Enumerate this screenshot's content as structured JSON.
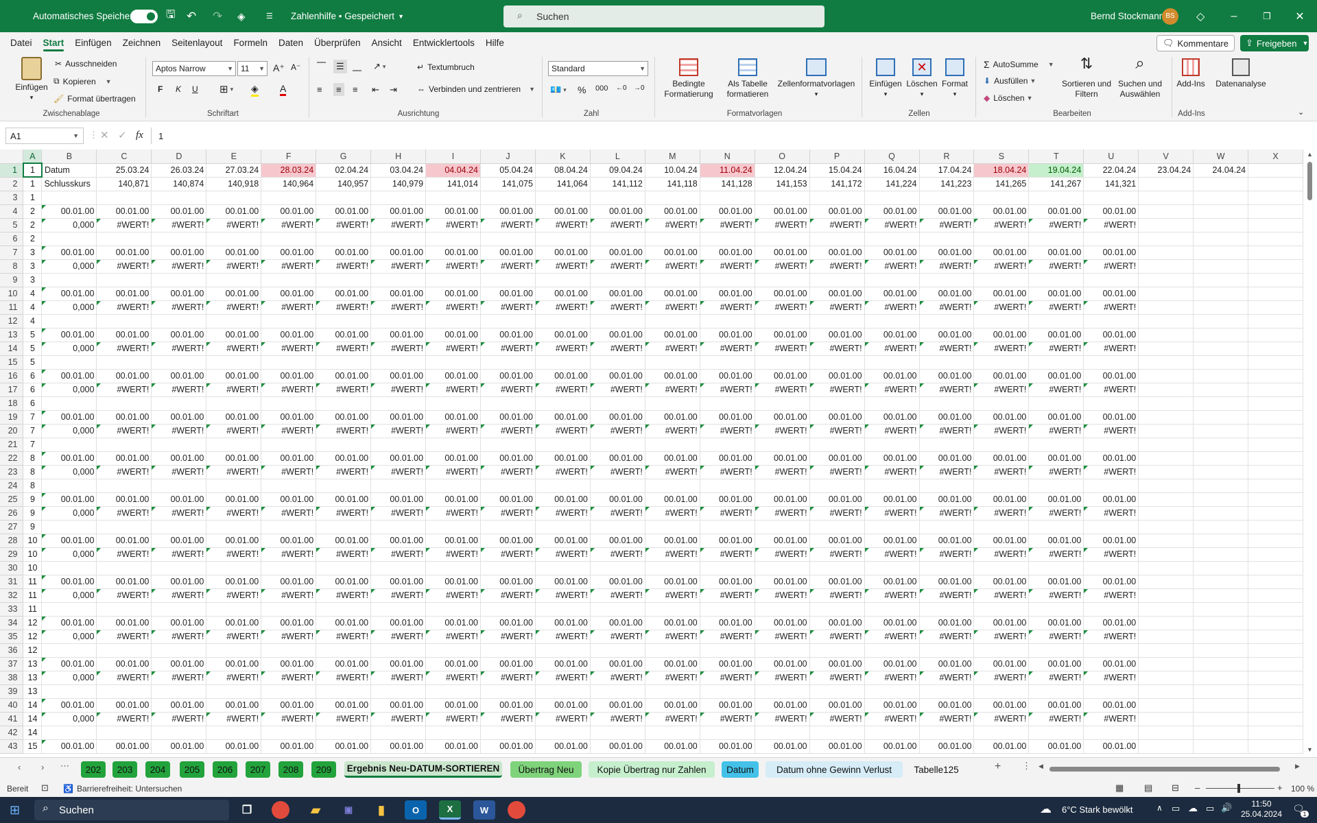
{
  "titlebar": {
    "autosave_label": "Automatisches Speichern",
    "document_title": "Zahlenhilfe • Gespeichert",
    "search_placeholder": "Suchen",
    "user_name": "Bernd Stockmann",
    "user_initials": "BS",
    "minimize": "–",
    "maximize": "❐",
    "close": "✕"
  },
  "menu": {
    "items": [
      "Datei",
      "Start",
      "Einfügen",
      "Zeichnen",
      "Seitenlayout",
      "Formeln",
      "Daten",
      "Überprüfen",
      "Ansicht",
      "Entwicklertools",
      "Hilfe"
    ],
    "active": "Start",
    "comments": "Kommentare",
    "share": "Freigeben"
  },
  "ribbon": {
    "clipboard": {
      "paste": "Einfügen",
      "cut": "Ausschneiden",
      "copy": "Kopieren",
      "format_painter": "Format übertragen",
      "label": "Zwischenablage"
    },
    "font": {
      "font_name": "Aptos Narrow",
      "font_size": "11",
      "bold": "F",
      "italic": "K",
      "underline": "U",
      "label": "Schriftart"
    },
    "alignment": {
      "wrap": "Textumbruch",
      "merge": "Verbinden und zentrieren",
      "label": "Ausrichtung"
    },
    "number": {
      "format": "Standard",
      "label": "Zahl"
    },
    "styles": {
      "conditional": "Bedingte Formatierung",
      "as_table": "Als Tabelle formatieren",
      "cell_styles": "Zellenformatvorlagen",
      "label": "Formatvorlagen"
    },
    "cells": {
      "insert": "Einfügen",
      "delete": "Löschen",
      "format": "Format",
      "label": "Zellen"
    },
    "editing": {
      "autosum": "AutoSumme",
      "fill": "Ausfüllen",
      "clear": "Löschen",
      "sort": "Sortieren und Filtern",
      "find": "Suchen und Auswählen",
      "label": "Bearbeiten"
    },
    "addins": {
      "addins": "Add-Ins",
      "analyze": "Datenanalyse",
      "label": "Add-Ins"
    }
  },
  "formula_bar": {
    "name_box": "A1",
    "fx": "fx",
    "content": "1"
  },
  "grid": {
    "columns": [
      "A",
      "B",
      "C",
      "D",
      "E",
      "F",
      "G",
      "H",
      "I",
      "J",
      "K",
      "L",
      "M",
      "N",
      "O",
      "P",
      "Q",
      "R",
      "S",
      "T",
      "U",
      "V",
      "W",
      "X"
    ],
    "dates": [
      "25.03.24",
      "26.03.24",
      "27.03.24",
      "28.03.24",
      "02.04.24",
      "03.04.24",
      "04.04.24",
      "05.04.24",
      "08.04.24",
      "09.04.24",
      "10.04.24",
      "11.04.24",
      "12.04.24",
      "15.04.24",
      "16.04.24",
      "17.04.24",
      "18.04.24",
      "19.04.24",
      "22.04.24",
      "23.04.24",
      "24.04.24"
    ],
    "kurse": [
      "140,871",
      "140,874",
      "140,918",
      "140,964",
      "140,957",
      "140,979",
      "141,014",
      "141,075",
      "141,064",
      "141,112",
      "141,118",
      "141,128",
      "141,153",
      "141,172",
      "141,224",
      "141,223",
      "141,265",
      "141,267",
      "141,321"
    ],
    "row1_label": "Datum",
    "row2_label": "Schlusskurs",
    "date_cell": "00.01.00",
    "error_cell": "#WERT!",
    "zero_cell": "0,000",
    "rows": [
      {
        "n": "1",
        "a": "1",
        "kind": "date"
      },
      {
        "n": "2",
        "a": "1",
        "kind": "kurs"
      },
      {
        "n": "3",
        "a": "1",
        "kind": "empty"
      },
      {
        "n": "4",
        "a": "2",
        "kind": "d"
      },
      {
        "n": "5",
        "a": "2",
        "kind": "e"
      },
      {
        "n": "6",
        "a": "2",
        "kind": "empty"
      },
      {
        "n": "7",
        "a": "3",
        "kind": "d"
      },
      {
        "n": "8",
        "a": "3",
        "kind": "e"
      },
      {
        "n": "9",
        "a": "3",
        "kind": "empty"
      },
      {
        "n": "10",
        "a": "4",
        "kind": "d"
      },
      {
        "n": "11",
        "a": "4",
        "kind": "e"
      },
      {
        "n": "12",
        "a": "4",
        "kind": "empty"
      },
      {
        "n": "13",
        "a": "5",
        "kind": "d"
      },
      {
        "n": "14",
        "a": "5",
        "kind": "e"
      },
      {
        "n": "15",
        "a": "5",
        "kind": "empty"
      },
      {
        "n": "16",
        "a": "6",
        "kind": "d"
      },
      {
        "n": "17",
        "a": "6",
        "kind": "e"
      },
      {
        "n": "18",
        "a": "6",
        "kind": "empty"
      },
      {
        "n": "19",
        "a": "7",
        "kind": "d"
      },
      {
        "n": "20",
        "a": "7",
        "kind": "e"
      },
      {
        "n": "21",
        "a": "7",
        "kind": "empty"
      },
      {
        "n": "22",
        "a": "8",
        "kind": "d"
      },
      {
        "n": "23",
        "a": "8",
        "kind": "e"
      },
      {
        "n": "24",
        "a": "8",
        "kind": "empty"
      },
      {
        "n": "25",
        "a": "9",
        "kind": "d"
      },
      {
        "n": "26",
        "a": "9",
        "kind": "e"
      },
      {
        "n": "27",
        "a": "9",
        "kind": "empty"
      },
      {
        "n": "28",
        "a": "10",
        "kind": "d"
      },
      {
        "n": "29",
        "a": "10",
        "kind": "e"
      },
      {
        "n": "30",
        "a": "10",
        "kind": "empty"
      },
      {
        "n": "31",
        "a": "11",
        "kind": "d"
      },
      {
        "n": "32",
        "a": "11",
        "kind": "e"
      },
      {
        "n": "33",
        "a": "11",
        "kind": "empty"
      },
      {
        "n": "34",
        "a": "12",
        "kind": "d"
      },
      {
        "n": "35",
        "a": "12",
        "kind": "e"
      },
      {
        "n": "36",
        "a": "12",
        "kind": "empty"
      },
      {
        "n": "37",
        "a": "13",
        "kind": "d"
      },
      {
        "n": "38",
        "a": "13",
        "kind": "e"
      },
      {
        "n": "39",
        "a": "13",
        "kind": "empty"
      },
      {
        "n": "40",
        "a": "14",
        "kind": "d"
      },
      {
        "n": "41",
        "a": "14",
        "kind": "e"
      },
      {
        "n": "42",
        "a": "14",
        "kind": "empty"
      },
      {
        "n": "43",
        "a": "15",
        "kind": "d"
      }
    ],
    "red_columns": [
      "F",
      "I",
      "N",
      "S"
    ],
    "green_columns": [
      "T"
    ]
  },
  "sheet_tabs": [
    {
      "label": "202",
      "color": "#22a33c"
    },
    {
      "label": "203",
      "color": "#22a33c"
    },
    {
      "label": "204",
      "color": "#22a33c"
    },
    {
      "label": "205",
      "color": "#22a33c"
    },
    {
      "label": "206",
      "color": "#22a33c"
    },
    {
      "label": "207",
      "color": "#22a33c"
    },
    {
      "label": "208",
      "color": "#22a33c"
    },
    {
      "label": "209",
      "color": "#22a33c"
    },
    {
      "label": "Ergebnis Neu-DATUM-SORTIEREN",
      "color": "#c9e6cd"
    },
    {
      "label": "Übertrag Neu",
      "color": "#7fd37b"
    },
    {
      "label": "Kopie Übertrag nur Zahlen",
      "color": "#c6efce"
    },
    {
      "label": "Datum",
      "color": "#43c1e8"
    },
    {
      "label": "Datum ohne Gewinn Verlust",
      "color": "#d6ecf7"
    },
    {
      "label": "Tabelle125",
      "color": "#f3f3f3"
    }
  ],
  "statusbar": {
    "ready": "Bereit",
    "accessibility": "Barrierefreiheit: Untersuchen",
    "zoom": "100 %"
  },
  "taskbar": {
    "search": "Suchen",
    "weather": "6°C  Stark bewölkt",
    "time": "11:50",
    "date": "25.04.2024",
    "notif": "1"
  }
}
